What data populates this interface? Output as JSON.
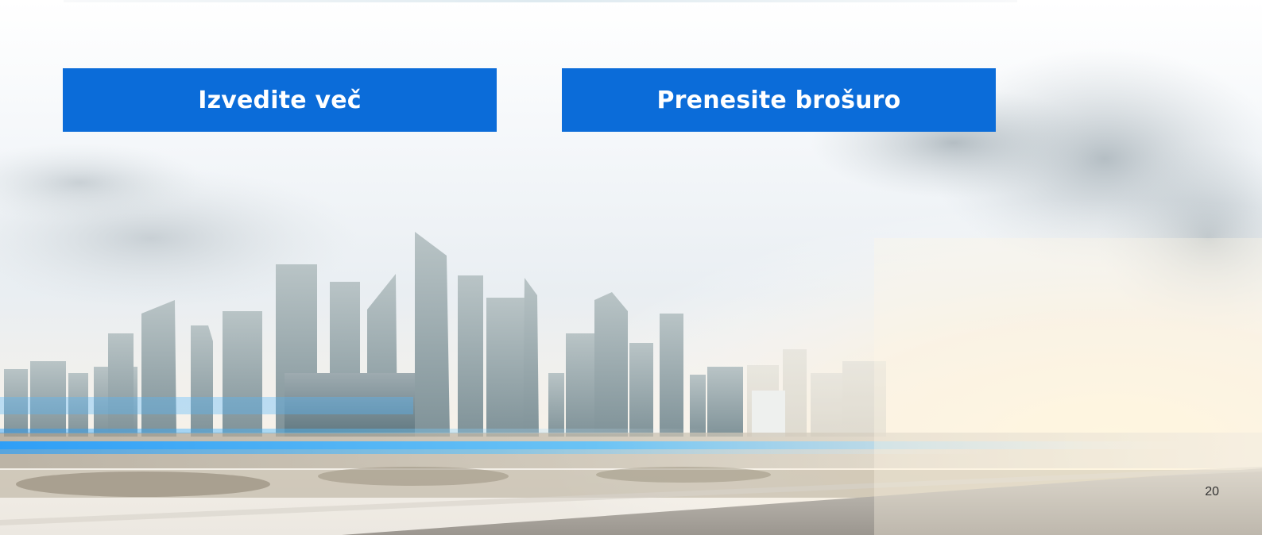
{
  "slide": {
    "buttons": {
      "learn_more_label": "Izvedite več",
      "download_brochure_label": "Prenesite brošuro"
    },
    "page_number": "20"
  },
  "colors": {
    "button_bg": "#0b6cd9",
    "button_text": "#ffffff",
    "light_streak": "#27a9ff"
  },
  "background": {
    "scene": "city-skyline-road-photo"
  }
}
